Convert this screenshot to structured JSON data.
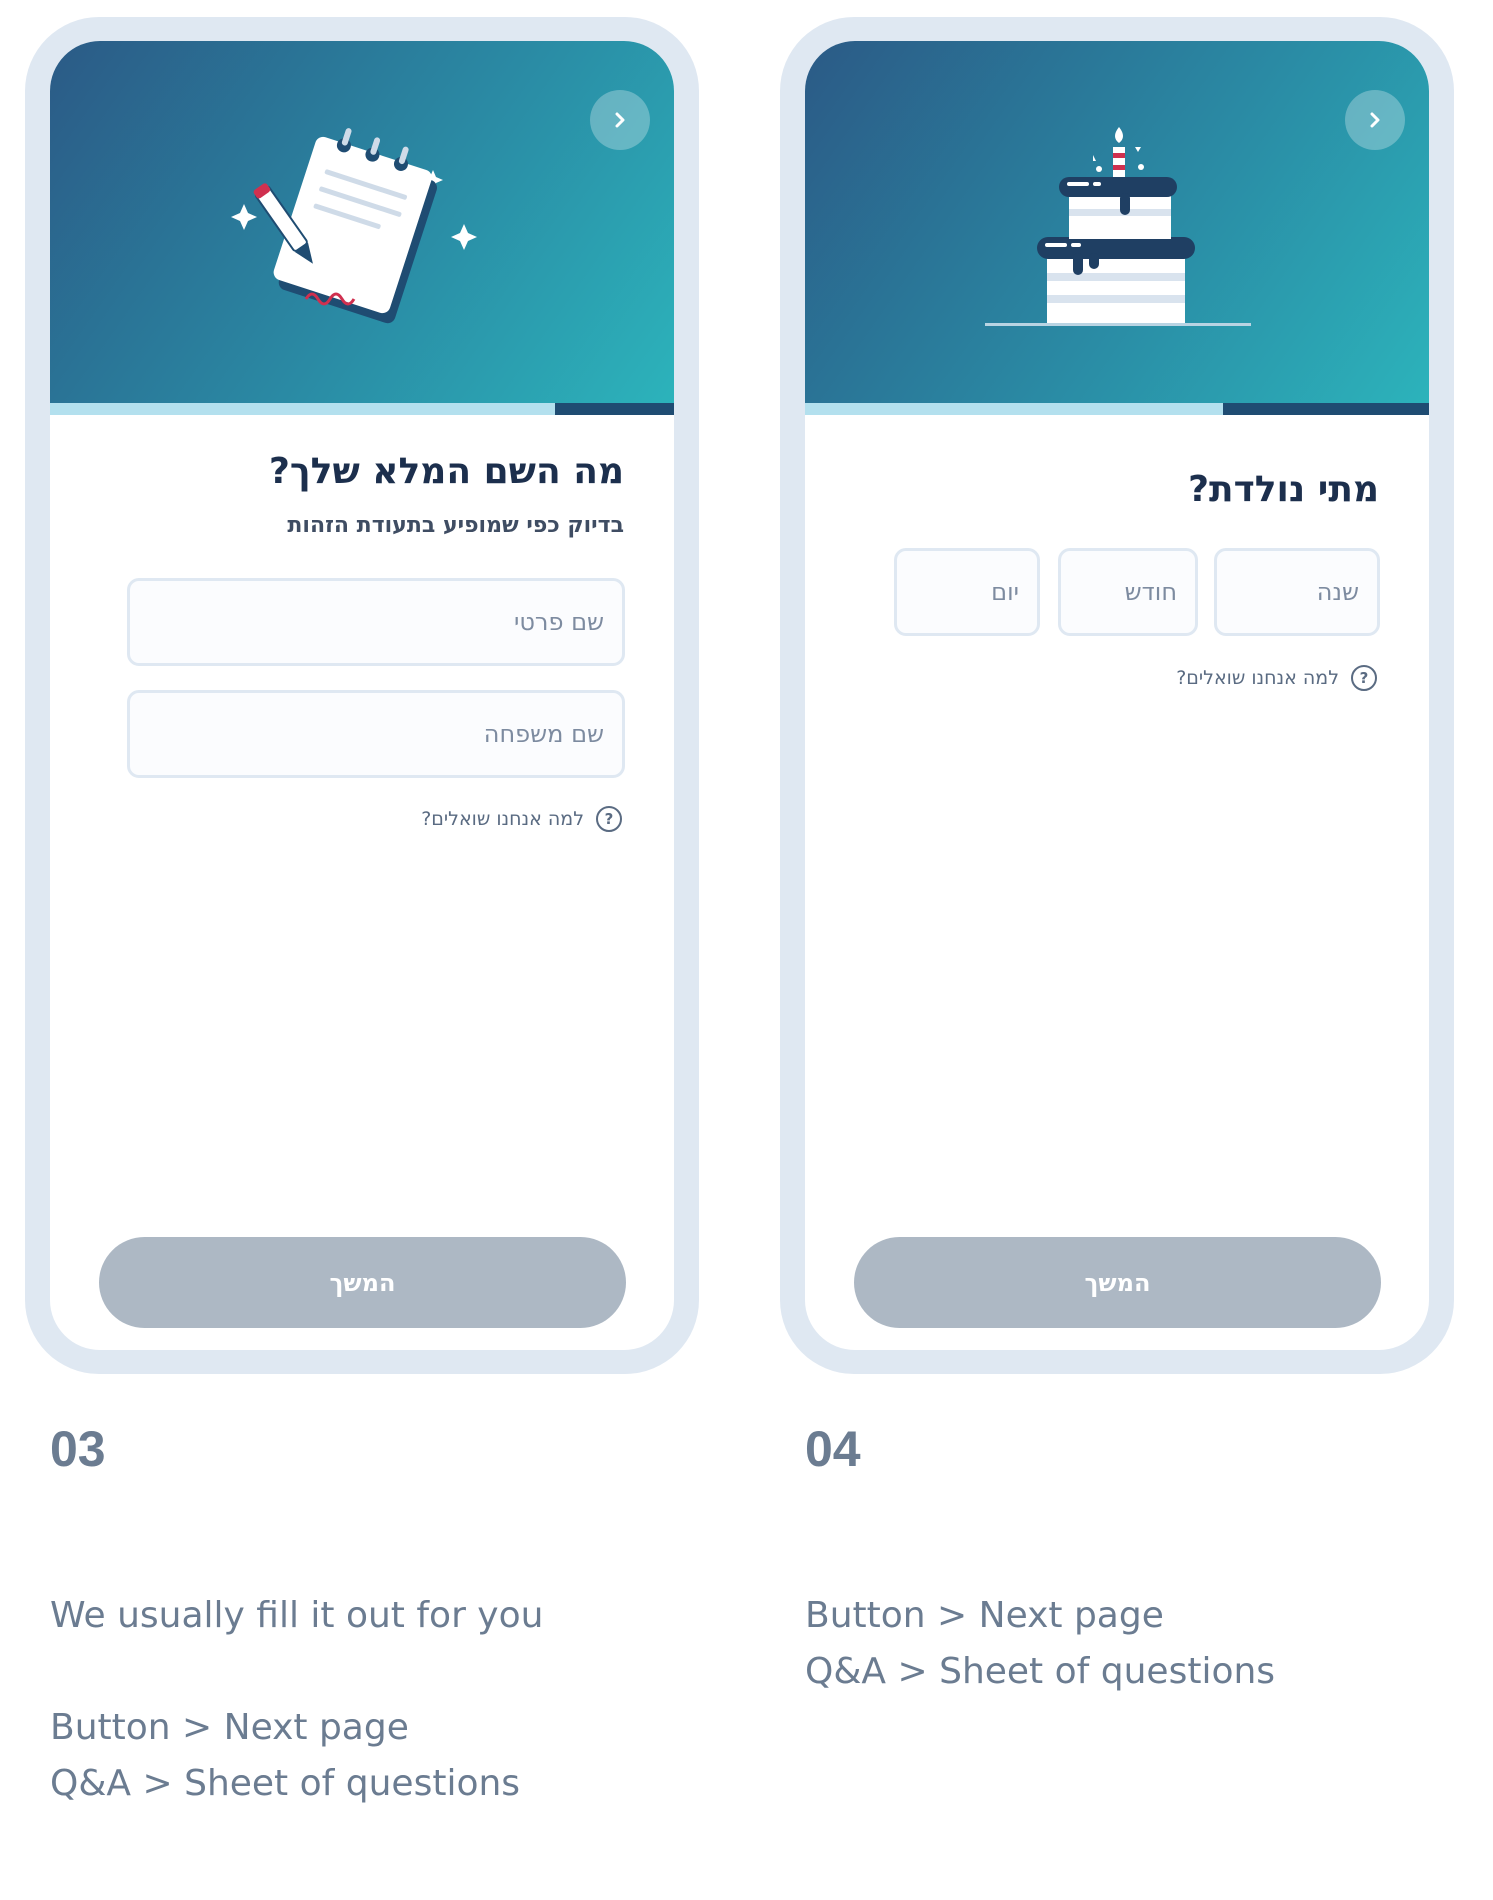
{
  "screens": [
    {
      "number": "03",
      "title": "מה השם המלא שלך?",
      "subtitle": "בדיוק כפי שמופיע בתעודת הזהות",
      "fields": [
        {
          "placeholder": "שם פרטי",
          "value": ""
        },
        {
          "placeholder": "שם משפחה",
          "value": ""
        }
      ],
      "why_link": "למה אנחנו שואלים?",
      "continue_label": "המשך",
      "progress": 0.19,
      "notes": [
        "We usually fill it out for you",
        "",
        "Button > Next page",
        "Q&A > Sheet of questions"
      ]
    },
    {
      "number": "04",
      "title": "מתי נולדת?",
      "fields": [
        {
          "placeholder": "שנה",
          "value": ""
        },
        {
          "placeholder": "חודש",
          "value": ""
        },
        {
          "placeholder": "יום",
          "value": ""
        }
      ],
      "why_link": "למה אנחנו שואלים?",
      "continue_label": "המשך",
      "progress": 0.33,
      "notes": [
        "Button > Next page",
        "Q&A > Sheet of questions"
      ]
    }
  ],
  "colors": {
    "hero_start": "#2b5a86",
    "hero_end": "#2cb3bb",
    "progress_track": "#b3e0ee",
    "progress_fill": "#1f4c72",
    "button_disabled": "#adb8c4",
    "frame": "#dfe8f2",
    "title": "#1c2f4d"
  },
  "icons": {
    "back": "chevron-right-icon",
    "help": "question-circle-icon",
    "illustration_1": "notepad-pencil-illustration",
    "illustration_2": "birthday-cake-illustration"
  }
}
